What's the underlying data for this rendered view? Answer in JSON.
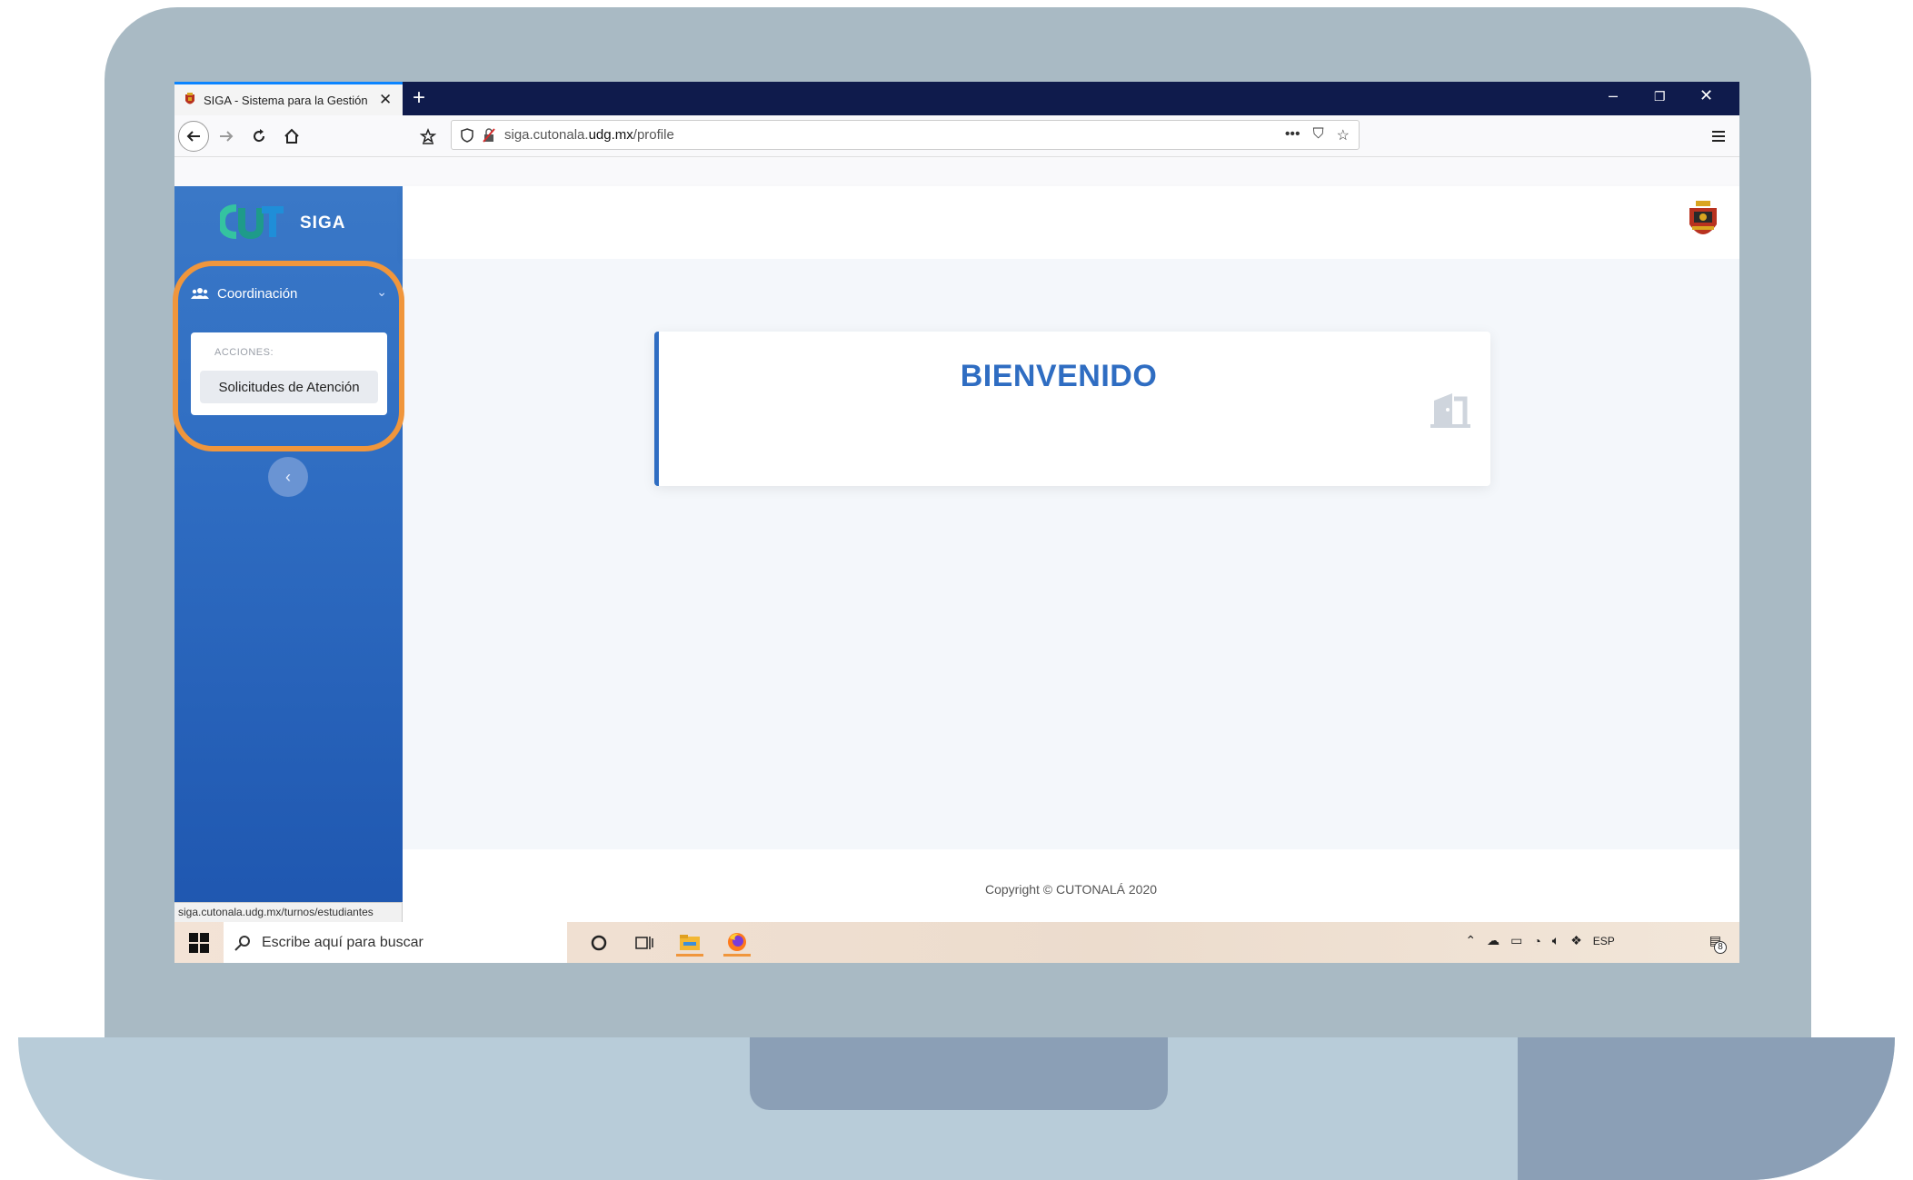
{
  "browser": {
    "tab_title": "SIGA - Sistema para la Gestión",
    "tab_close": "✕",
    "new_tab": "+",
    "url_prefix": "siga.cutonala.",
    "url_domain": "udg.mx",
    "url_path": "/profile",
    "status_url": "siga.cutonala.udg.mx/turnos/estudiantes"
  },
  "sidebar": {
    "brand": "SIGA",
    "menu_label": "Coordinación",
    "submenu_header": "ACCIONES:",
    "submenu_item": "Solicitudes de Atención"
  },
  "main": {
    "welcome_title": "BIENVENIDO",
    "copyright": "Copyright © CUTONALÁ 2020"
  },
  "taskbar": {
    "search_placeholder": "Escribe aquí para buscar",
    "language": "ESP",
    "notification_count": "8"
  },
  "colors": {
    "accent": "#2f6dc2",
    "highlight": "#f0963c",
    "tabbar": "#0f1b4c"
  }
}
